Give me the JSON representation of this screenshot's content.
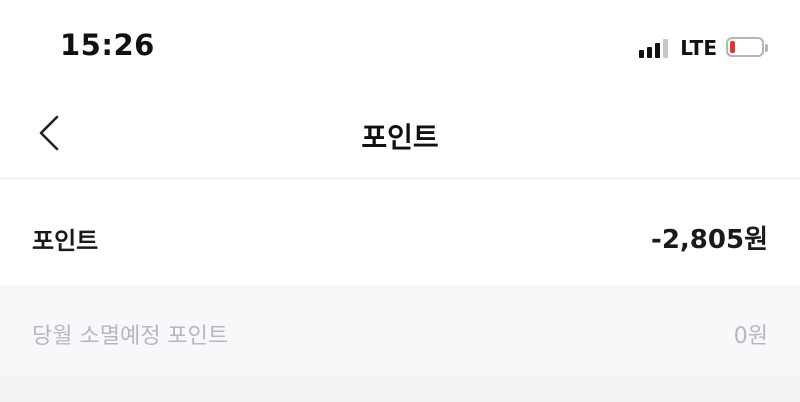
{
  "status_bar": {
    "time": "15:26",
    "network": "LTE",
    "signal_bars_active": 3,
    "signal_bars_total": 4,
    "battery_level": 0.15,
    "battery_color": "#e1372f",
    "icons": [
      "signal-icon",
      "battery-icon"
    ]
  },
  "header": {
    "back_icon": "chevron-left-icon",
    "title": "포인트"
  },
  "points": {
    "label": "포인트",
    "value": "-2,805원"
  },
  "expiry": {
    "label": "당월 소멸예정 포인트",
    "value": "0원"
  }
}
